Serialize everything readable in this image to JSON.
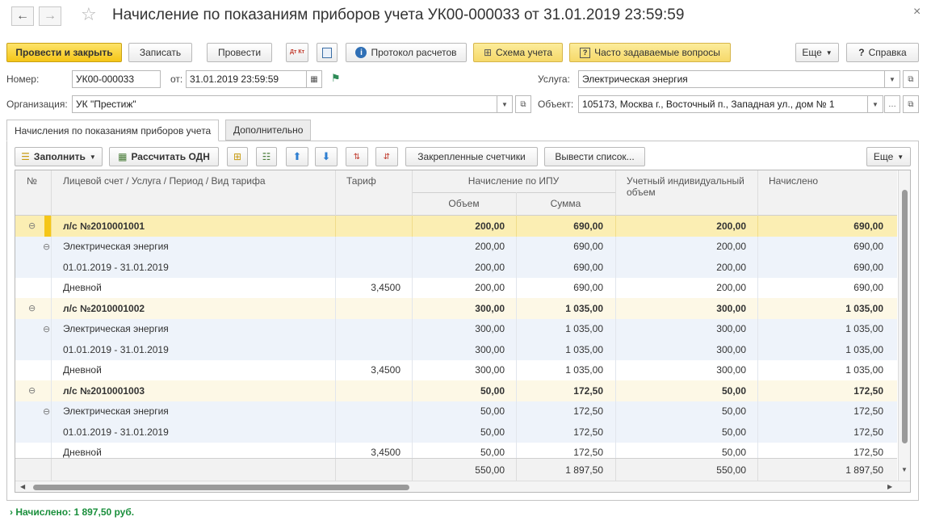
{
  "window": {
    "title": "Начисление по показаниям приборов учета УК00-000033 от 31.01.2019 23:59:59"
  },
  "toolbar": {
    "post_close": "Провести и закрыть",
    "save": "Записать",
    "post": "Провести",
    "dtkt": "Дт Кт",
    "protocol": "Протокол расчетов",
    "scheme": "Схема учета",
    "faq": "Часто задаваемые вопросы",
    "more": "Еще",
    "help": "Справка"
  },
  "form": {
    "number_label": "Номер:",
    "number_value": "УК00-000033",
    "date_label": "от:",
    "date_value": "31.01.2019 23:59:59",
    "org_label": "Организация:",
    "org_value": "УК \"Престиж\"",
    "service_label": "Услуга:",
    "service_value": "Электрическая энергия",
    "object_label": "Объект:",
    "object_value": "105173, Москва г., Восточный п., Западная ул., дом № 1"
  },
  "tabs": [
    {
      "label": "Начисления по показаниям приборов учета"
    },
    {
      "label": "Дополнительно"
    }
  ],
  "table_toolbar": {
    "fill": "Заполнить",
    "calc_odn": "Рассчитать ОДН",
    "pinned": "Закрепленные счетчики",
    "output_list": "Вывести список...",
    "more": "Еще"
  },
  "table": {
    "headers": {
      "num": "№",
      "account": "Лицевой счет / Услуга / Период / Вид тарифа",
      "tariff": "Тариф",
      "ipu": "Начисление по ИПУ",
      "volume": "Объем",
      "sum": "Сумма",
      "individual": "Учетный индивидуальный объем",
      "charged": "Начислено"
    },
    "rows": [
      {
        "level": 0,
        "text": "л/с №2010001001",
        "tariff": "",
        "volume": "200,00",
        "sum": "690,00",
        "individual": "200,00",
        "charged": "690,00"
      },
      {
        "level": 1,
        "text": "Электрическая энергия",
        "tariff": "",
        "volume": "200,00",
        "sum": "690,00",
        "individual": "200,00",
        "charged": "690,00"
      },
      {
        "level": 2,
        "text": "01.01.2019 - 31.01.2019",
        "tariff": "",
        "volume": "200,00",
        "sum": "690,00",
        "individual": "200,00",
        "charged": "690,00"
      },
      {
        "level": 3,
        "text": "Дневной",
        "tariff": "3,4500",
        "volume": "200,00",
        "sum": "690,00",
        "individual": "200,00",
        "charged": "690,00"
      },
      {
        "level": 0,
        "text": "л/с №2010001002",
        "tariff": "",
        "volume": "300,00",
        "sum": "1 035,00",
        "individual": "300,00",
        "charged": "1 035,00"
      },
      {
        "level": 1,
        "text": "Электрическая энергия",
        "tariff": "",
        "volume": "300,00",
        "sum": "1 035,00",
        "individual": "300,00",
        "charged": "1 035,00"
      },
      {
        "level": 2,
        "text": "01.01.2019 - 31.01.2019",
        "tariff": "",
        "volume": "300,00",
        "sum": "1 035,00",
        "individual": "300,00",
        "charged": "1 035,00"
      },
      {
        "level": 3,
        "text": "Дневной",
        "tariff": "3,4500",
        "volume": "300,00",
        "sum": "1 035,00",
        "individual": "300,00",
        "charged": "1 035,00"
      },
      {
        "level": 0,
        "text": "л/с №2010001003",
        "tariff": "",
        "volume": "50,00",
        "sum": "172,50",
        "individual": "50,00",
        "charged": "172,50"
      },
      {
        "level": 1,
        "text": "Электрическая энергия",
        "tariff": "",
        "volume": "50,00",
        "sum": "172,50",
        "individual": "50,00",
        "charged": "172,50"
      },
      {
        "level": 2,
        "text": "01.01.2019 - 31.01.2019",
        "tariff": "",
        "volume": "50,00",
        "sum": "172,50",
        "individual": "50,00",
        "charged": "172,50"
      },
      {
        "level": 3,
        "text": "Дневной",
        "tariff": "3,4500",
        "volume": "50,00",
        "sum": "172,50",
        "individual": "50,00",
        "charged": "172,50"
      }
    ],
    "totals": {
      "volume": "550,00",
      "sum": "1 897,50",
      "individual": "550,00",
      "charged": "1 897,50"
    }
  },
  "status": {
    "text": "Начислено: 1 897,50 руб."
  },
  "colors": {
    "selected_row": "#fbeeb3",
    "group_row": "#fdf8e6",
    "alt_row": "#eef3fa",
    "accent_yellow": "#f5c617",
    "status_green": "#1a8f3c"
  }
}
